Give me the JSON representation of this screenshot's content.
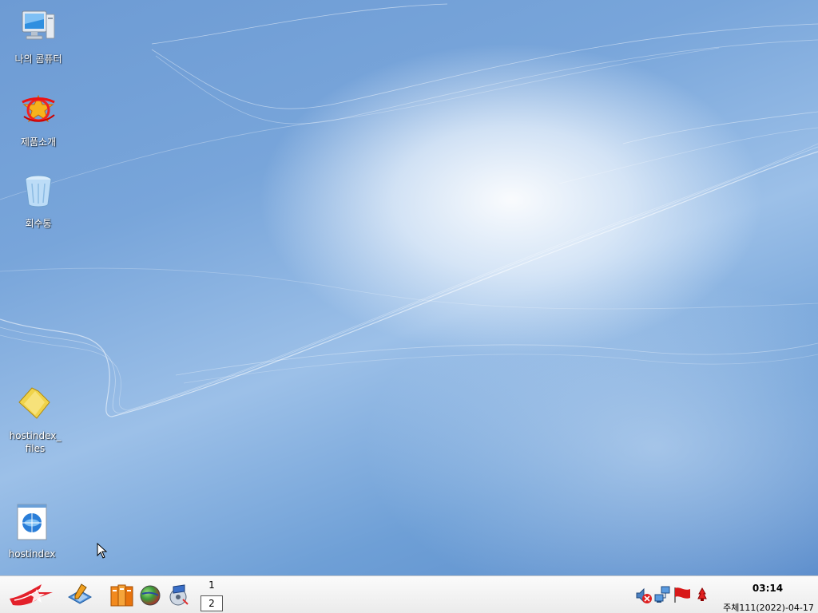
{
  "desktop": {
    "icons": [
      {
        "label": "나의 콤퓨터",
        "icon": "computer-icon"
      },
      {
        "label": "제품소개",
        "icon": "product-intro-icon"
      },
      {
        "label": "회수통",
        "icon": "recycle-bin-icon"
      },
      {
        "label": "hostindex_\nfiles",
        "icon": "folder-icon"
      },
      {
        "label": "hostindex",
        "icon": "html-document-icon"
      }
    ]
  },
  "taskbar": {
    "start_icon": "red-star-start-icon",
    "launchers": [
      "text-editor-icon",
      "office-suite-icon",
      "web-browser-globe-icon",
      "media-player-icon"
    ],
    "workspaces": [
      "1",
      "2"
    ],
    "active_workspace": "2",
    "tray_icons": [
      "volume-muted-icon",
      "network-icon",
      "red-flag-icon",
      "notification-icon"
    ],
    "clock": {
      "time": "03:14",
      "date": "주체111(2022)-04-17"
    }
  },
  "colors": {
    "desktop_accent": "#6d9bd4",
    "taskbar_bg": "#f3f3f3"
  }
}
